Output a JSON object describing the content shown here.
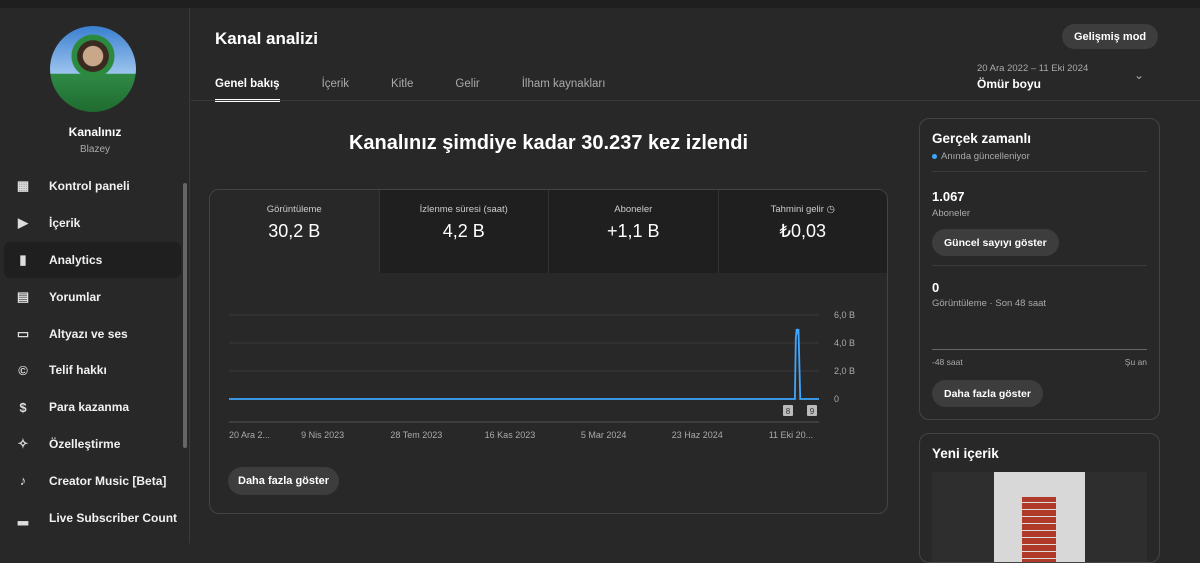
{
  "sidebar": {
    "channel_label": "Kanalınız",
    "channel_name": "Blazey",
    "items": [
      {
        "label": "Kontrol paneli",
        "icon": "dashboard-icon"
      },
      {
        "label": "İçerik",
        "icon": "content-icon"
      },
      {
        "label": "Analytics",
        "icon": "analytics-icon",
        "active": true
      },
      {
        "label": "Yorumlar",
        "icon": "comments-icon"
      },
      {
        "label": "Altyazı ve ses",
        "icon": "subtitles-icon"
      },
      {
        "label": "Telif hakkı",
        "icon": "copyright-icon"
      },
      {
        "label": "Para kazanma",
        "icon": "dollar-icon"
      },
      {
        "label": "Özelleştirme",
        "icon": "magic-wand-icon"
      },
      {
        "label": "Creator Music [Beta]",
        "icon": "music-icon"
      },
      {
        "label": "Live Subscriber Count",
        "icon": "signal-bars-icon"
      }
    ]
  },
  "header": {
    "title": "Kanal analizi",
    "advanced_mode": "Gelişmiş mod",
    "date_range": "20 Ara 2022 – 11 Eki 2024",
    "period": "Ömür boyu",
    "tabs": [
      {
        "label": "Genel bakış",
        "active": true
      },
      {
        "label": "İçerik"
      },
      {
        "label": "Kitle"
      },
      {
        "label": "Gelir"
      },
      {
        "label": "İlham kaynakları"
      }
    ]
  },
  "main": {
    "headline": "Kanalınız şimdiye kadar 30.237 kez izlendi",
    "metrics": [
      {
        "label": "Görüntüleme",
        "value": "30,2 B"
      },
      {
        "label": "İzlenme süresi (saat)",
        "value": "4,2 B"
      },
      {
        "label": "Aboneler",
        "value": "+1,1 B"
      },
      {
        "label": "Tahmini gelir",
        "value": "₺0,03"
      }
    ],
    "more_button": "Daha fazla göster"
  },
  "chart_data": {
    "type": "line",
    "color": "#3ea6ff",
    "ylim": [
      0,
      6
    ],
    "yticks": [
      "0",
      "2,0 B",
      "4,0 B",
      "6,0 B"
    ],
    "xticks": [
      "20 Ara 2...",
      "9 Nis 2023",
      "28 Tem 2023",
      "16 Kas 2023",
      "5 Mar 2024",
      "23 Haz 2024",
      "11 Eki 20..."
    ],
    "xrange": [
      "2022-12-20",
      "2024-10-11"
    ],
    "points": [
      [
        "2022-12-20",
        0
      ],
      [
        "2024-09-14",
        0
      ],
      [
        "2024-09-15",
        4.3
      ],
      [
        "2024-09-16",
        5.0
      ],
      [
        "2024-09-17",
        4.8
      ],
      [
        "2024-09-18",
        5.0
      ],
      [
        "2024-09-20",
        0
      ],
      [
        "2024-10-11",
        0
      ]
    ],
    "markers": [
      "8",
      "9"
    ]
  },
  "realtime": {
    "title": "Gerçek zamanlı",
    "live": "Anında güncelleniyor",
    "subs": "1.067",
    "subs_label": "Aboneler",
    "show_count": "Güncel sayıyı göster",
    "views": "0",
    "views_label": "Görüntüleme · Son 48 saat",
    "axis_start": "-48 saat",
    "axis_end": "Şu an",
    "more": "Daha fazla göster"
  },
  "new_content": {
    "title": "Yeni içerik"
  }
}
